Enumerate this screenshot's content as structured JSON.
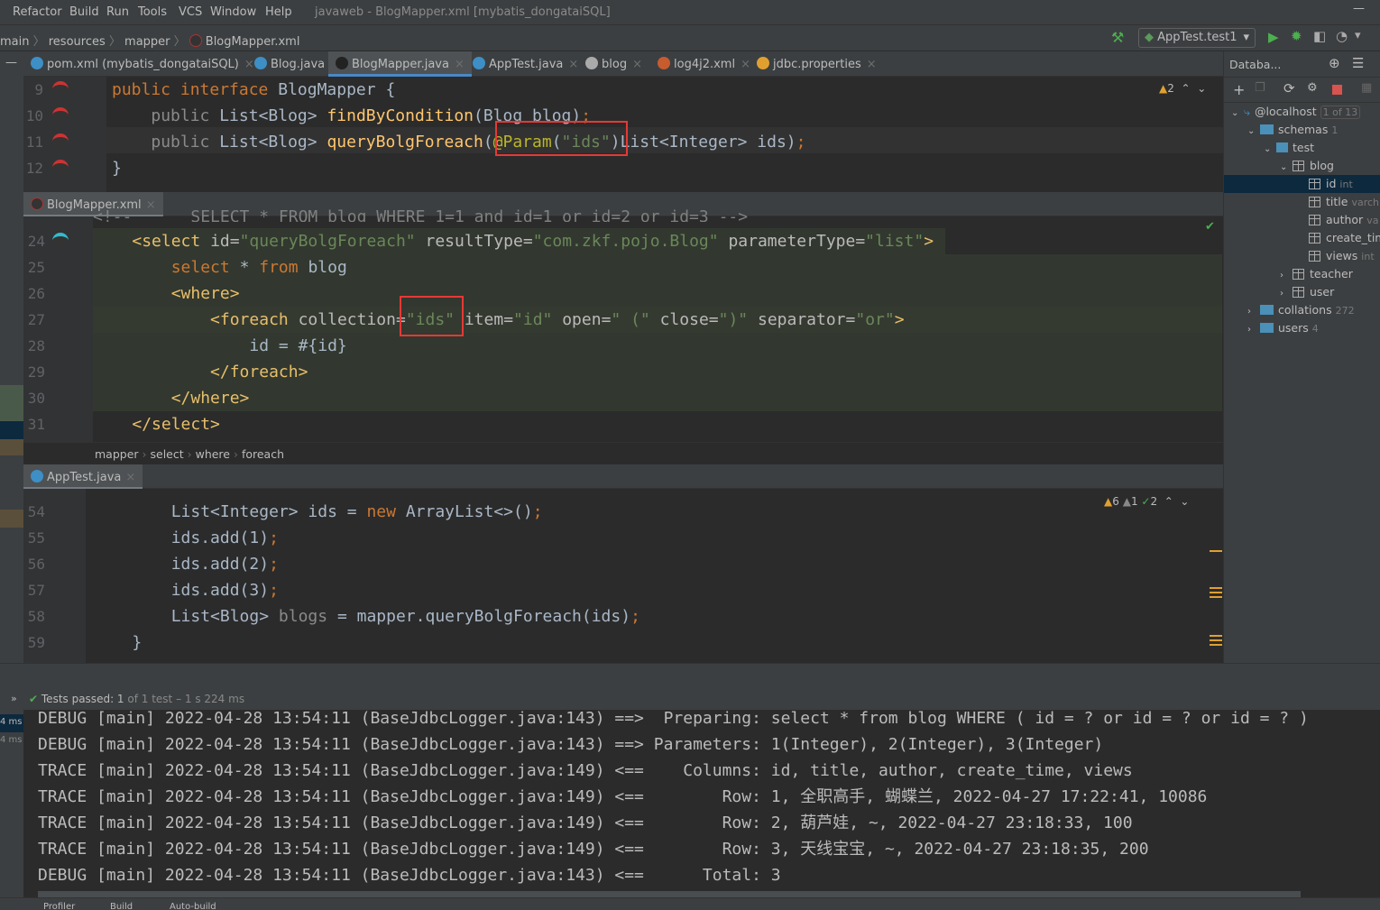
{
  "menu": {
    "items": [
      "Refactor",
      "Build",
      "Run",
      "Tools",
      "VCS",
      "Window",
      "Help"
    ],
    "window_title": "javaweb - BlogMapper.xml [mybatis_dongataiSQL]"
  },
  "breadcrumb": {
    "items": [
      "main",
      "resources",
      "mapper",
      "BlogMapper.xml"
    ]
  },
  "toolbar": {
    "run_config": "AppTest.test1"
  },
  "tabs": [
    {
      "label": "pom.xml (mybatis_dongataiSQL)",
      "icon": "maven-icon",
      "color": "#3d8fc6"
    },
    {
      "label": "Blog.java",
      "icon": "class-icon",
      "color": "#3d8fc6"
    },
    {
      "label": "BlogMapper.java",
      "icon": "mybatis-icon",
      "color": "#222",
      "active": true
    },
    {
      "label": "AppTest.java",
      "icon": "test-class-icon",
      "color": "#3d8fc6"
    },
    {
      "label": "blog",
      "icon": "table-icon",
      "color": "#aaa"
    },
    {
      "label": "log4j2.xml",
      "icon": "xml-file-icon",
      "color": "#c75c2e"
    },
    {
      "label": "jdbc.properties",
      "icon": "properties-file-icon",
      "color": "#e0a030"
    }
  ],
  "editor1": {
    "warnings": "2",
    "lines": [
      {
        "n": "9",
        "seg": [
          [
            "public interface ",
            "kw"
          ],
          [
            "BlogMapper {",
            "pl"
          ]
        ]
      },
      {
        "n": "10",
        "seg": [
          [
            "    ",
            "pl"
          ],
          [
            "public ",
            "dim"
          ],
          [
            "List<Blog> ",
            "pl"
          ],
          [
            "findByCondition",
            "fn"
          ],
          [
            "(Blog blog)",
            "pl"
          ],
          [
            ";",
            "kw"
          ]
        ]
      },
      {
        "n": "11",
        "seg": [
          [
            "    ",
            "pl"
          ],
          [
            "public ",
            "dim"
          ],
          [
            "List<Blog> ",
            "pl"
          ],
          [
            "queryBolgForeach",
            "fn"
          ],
          [
            "(",
            "pl"
          ],
          [
            "@Param",
            "ann"
          ],
          [
            "(",
            "pl"
          ],
          [
            "\"ids\"",
            "str"
          ],
          [
            ")List<Integer> ids)",
            "pl"
          ],
          [
            ";",
            "kw"
          ]
        ]
      },
      {
        "n": "12",
        "seg": [
          [
            "}",
            "pl"
          ]
        ]
      }
    ]
  },
  "editor2": {
    "tab": "BlogMapper.xml",
    "partial_line": "<!--      SELECT * FROM blog WHERE 1=1 and id=1 or id=2 or id=3 -->",
    "lines": [
      {
        "n": "24",
        "seg": [
          [
            "    ",
            "pl"
          ],
          [
            "<select ",
            "tag"
          ],
          [
            "id=",
            "attr"
          ],
          [
            "\"queryBolgForeach\" ",
            "str"
          ],
          [
            "resultType=",
            "attr"
          ],
          [
            "\"com.zkf.pojo.Blog\" ",
            "str"
          ],
          [
            "parameterType=",
            "attr"
          ],
          [
            "\"list\"",
            "str"
          ],
          [
            ">",
            "tag"
          ]
        ]
      },
      {
        "n": "25",
        "seg": [
          [
            "        ",
            "pl"
          ],
          [
            "select ",
            "kw"
          ],
          [
            "* ",
            "pl"
          ],
          [
            "from ",
            "kw"
          ],
          [
            "blog",
            "pl"
          ]
        ]
      },
      {
        "n": "26",
        "seg": [
          [
            "        ",
            "pl"
          ],
          [
            "<where>",
            "tag"
          ]
        ]
      },
      {
        "n": "27",
        "seg": [
          [
            "            ",
            "pl"
          ],
          [
            "<foreach ",
            "tag"
          ],
          [
            "collection=",
            "attr"
          ],
          [
            "\"ids\" ",
            "str"
          ],
          [
            "item=",
            "attr"
          ],
          [
            "\"id\" ",
            "str"
          ],
          [
            "open=",
            "attr"
          ],
          [
            "\" (\" ",
            "str"
          ],
          [
            "close=",
            "attr"
          ],
          [
            "\")\" ",
            "str"
          ],
          [
            "separator=",
            "attr"
          ],
          [
            "\"or\"",
            "str"
          ],
          [
            ">",
            "tag"
          ]
        ]
      },
      {
        "n": "28",
        "seg": [
          [
            "                ",
            "pl"
          ],
          [
            "id = #{id}",
            "pl"
          ]
        ]
      },
      {
        "n": "29",
        "seg": [
          [
            "            ",
            "pl"
          ],
          [
            "</foreach>",
            "tag"
          ]
        ]
      },
      {
        "n": "30",
        "seg": [
          [
            "        ",
            "pl"
          ],
          [
            "</where>",
            "tag"
          ]
        ]
      },
      {
        "n": "31",
        "seg": [
          [
            "    ",
            "pl"
          ],
          [
            "</select>",
            "tag"
          ]
        ]
      }
    ],
    "crumbs": [
      "mapper",
      "select",
      "where",
      "foreach"
    ]
  },
  "editor3": {
    "tab": "AppTest.java",
    "warnings": "6",
    "weak_warnings": "1",
    "typos": "2",
    "lines": [
      {
        "n": "54",
        "seg": [
          [
            "        ",
            "pl"
          ],
          [
            "List<Integer> ids = ",
            "pl"
          ],
          [
            "new ",
            "kw"
          ],
          [
            "ArrayList<>()",
            "pl"
          ],
          [
            ";",
            "kw"
          ]
        ]
      },
      {
        "n": "55",
        "seg": [
          [
            "        ",
            "pl"
          ],
          [
            "ids.add(1)",
            "pl"
          ],
          [
            ";",
            "kw"
          ]
        ]
      },
      {
        "n": "56",
        "seg": [
          [
            "        ",
            "pl"
          ],
          [
            "ids.add(2)",
            "pl"
          ],
          [
            ";",
            "kw"
          ]
        ]
      },
      {
        "n": "57",
        "seg": [
          [
            "        ",
            "pl"
          ],
          [
            "ids.add(3)",
            "pl"
          ],
          [
            ";",
            "kw"
          ]
        ]
      },
      {
        "n": "58",
        "seg": [
          [
            "        ",
            "pl"
          ],
          [
            "List<Blog> ",
            "pl"
          ],
          [
            "blogs ",
            "dim"
          ],
          [
            "= mapper.queryBolgForeach(ids)",
            "pl"
          ],
          [
            ";",
            "kw"
          ]
        ]
      },
      {
        "n": "59",
        "seg": [
          [
            "    ",
            "pl"
          ],
          [
            "}",
            "pl"
          ]
        ]
      }
    ]
  },
  "database": {
    "title": "Databa...",
    "tree": [
      {
        "label": "@localhost",
        "meta": "1 of 13",
        "level": 0,
        "kind": "host",
        "open": true
      },
      {
        "label": "schemas",
        "meta": "1",
        "level": 1,
        "kind": "folder",
        "open": true
      },
      {
        "label": "test",
        "meta": "",
        "level": 2,
        "kind": "schema",
        "open": true
      },
      {
        "label": "blog",
        "meta": "",
        "level": 3,
        "kind": "table",
        "open": true
      },
      {
        "label": "id",
        "meta": "int",
        "level": 4,
        "kind": "column",
        "selected": true
      },
      {
        "label": "title",
        "meta": "varch",
        "level": 4,
        "kind": "column"
      },
      {
        "label": "author",
        "meta": "va",
        "level": 4,
        "kind": "column"
      },
      {
        "label": "create_tim",
        "meta": "",
        "level": 4,
        "kind": "column"
      },
      {
        "label": "views",
        "meta": "int",
        "level": 4,
        "kind": "column"
      },
      {
        "label": "teacher",
        "meta": "",
        "level": 3,
        "kind": "table",
        "open": false
      },
      {
        "label": "user",
        "meta": "",
        "level": 3,
        "kind": "table",
        "open": false
      },
      {
        "label": "collations",
        "meta": "272",
        "level": 1,
        "kind": "folder",
        "open": false
      },
      {
        "label": "users",
        "meta": "4",
        "level": 1,
        "kind": "folder",
        "open": false
      }
    ]
  },
  "run": {
    "status_bold": "Tests passed: 1",
    "status_rest": "of 1 test – 1 s 224 ms",
    "left_times": [
      "4 ms",
      "4 ms"
    ],
    "console": [
      "DEBUG [main] 2022-04-28 13:54:11 (BaseJdbcLogger.java:143) ==>  Preparing: select * from blog WHERE ( id = ? or id = ? or id = ? )",
      "DEBUG [main] 2022-04-28 13:54:11 (BaseJdbcLogger.java:143) ==> Parameters: 1(Integer), 2(Integer), 3(Integer)",
      "TRACE [main] 2022-04-28 13:54:11 (BaseJdbcLogger.java:149) <==    Columns: id, title, author, create_time, views",
      "TRACE [main] 2022-04-28 13:54:11 (BaseJdbcLogger.java:149) <==        Row: 1, 全职高手, 蝴蝶兰, 2022-04-27 17:22:41, 10086",
      "TRACE [main] 2022-04-28 13:54:11 (BaseJdbcLogger.java:149) <==        Row: 2, 葫芦娃, ~, 2022-04-27 23:18:33, 100",
      "TRACE [main] 2022-04-28 13:54:11 (BaseJdbcLogger.java:149) <==        Row: 3, 天线宝宝, ~, 2022-04-27 23:18:35, 200",
      "DEBUG [main] 2022-04-28 13:54:11 (BaseJdbcLogger.java:143) <==      Total: 3"
    ]
  },
  "statusbar": {
    "items": [
      "Profiler",
      "Build",
      "Auto-build"
    ]
  },
  "colors": {
    "accent": "#4a88c7",
    "highlight_box": "#e53935",
    "pass": "#4caf50",
    "warning": "#e0a030"
  }
}
